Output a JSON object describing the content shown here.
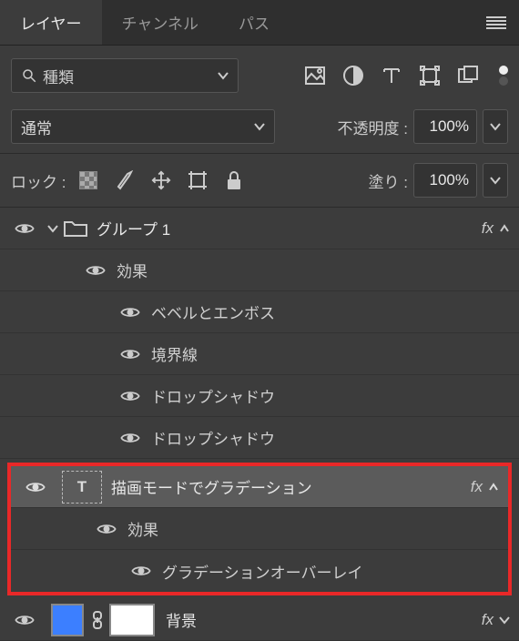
{
  "tabs": {
    "layers": "レイヤー",
    "channels": "チャンネル",
    "paths": "パス"
  },
  "search": {
    "kind": "種類"
  },
  "blend": {
    "mode": "通常"
  },
  "opacity": {
    "label": "不透明度 :",
    "value": "100%"
  },
  "lock": {
    "label": "ロック :"
  },
  "fill": {
    "label": "塗り :",
    "value": "100%"
  },
  "fx_label": "fx",
  "group": {
    "name": "グループ 1",
    "effects_label": "効果",
    "effects": [
      "ベベルとエンボス",
      "境界線",
      "ドロップシャドウ",
      "ドロップシャドウ"
    ]
  },
  "text_layer": {
    "name": "描画モードでグラデーション",
    "effects_label": "効果",
    "effects": [
      "グラデーションオーバーレイ"
    ]
  },
  "bg_layer": {
    "name": "背景"
  }
}
